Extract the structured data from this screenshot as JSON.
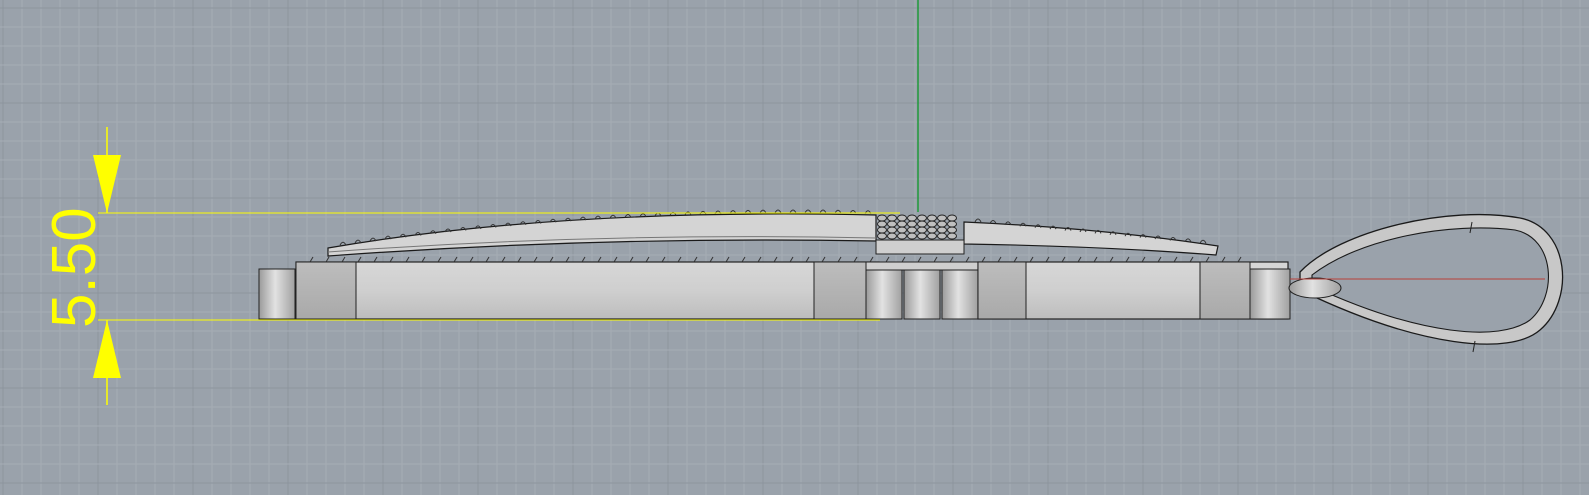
{
  "viewport": {
    "colors": {
      "background": "#9aa2ab",
      "grid_minor": "#a8afb7",
      "grid_major": "#8d959e",
      "axis_y": "#1f9a3a",
      "axis_x": "#b8403a",
      "dimension": "#ffff00",
      "part_fill": "#c9c9c9",
      "part_stroke": "#1a1a1a"
    },
    "dimension": {
      "value_text": "5.50"
    },
    "model": {
      "description_icon": "pendant-side-view-icon"
    }
  }
}
